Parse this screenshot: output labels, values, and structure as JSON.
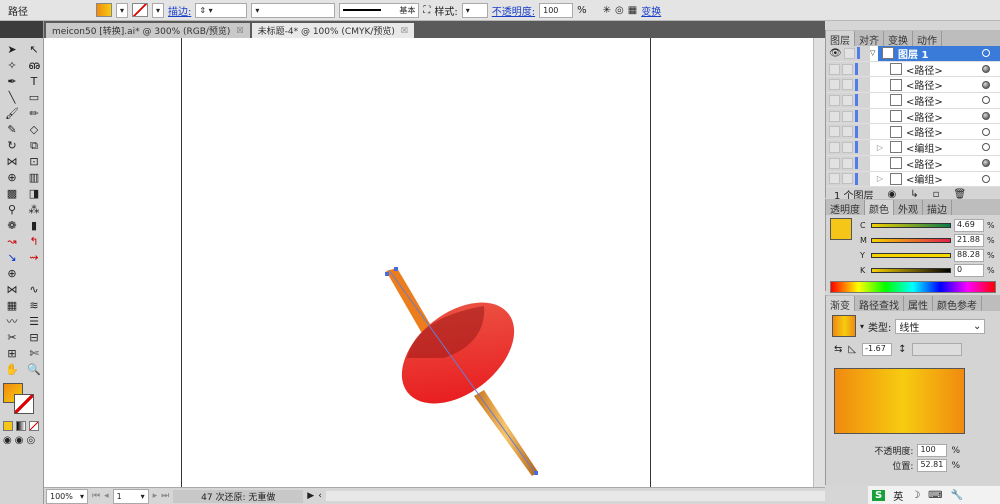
{
  "control_bar": {
    "object_type": "路径",
    "stroke_label": "描边:",
    "brush_label": "基本",
    "style_label": "样式:",
    "opacity_label": "不透明度:",
    "opacity_value": "100",
    "opacity_unit": "%",
    "transform_label": "变换"
  },
  "tabs": [
    {
      "label": "meicon50 [转换].ai* @ 300% (RGB/预览)",
      "active": false
    },
    {
      "label": "未标题-4* @ 100% (CMYK/预览)",
      "active": true
    }
  ],
  "status_bar": {
    "zoom": "100%",
    "page": "1",
    "message": "47 次还原: 无重做"
  },
  "layers_panel": {
    "tabs": [
      "图层",
      "对齐",
      "变换",
      "动作"
    ],
    "layer_name": "图层 1",
    "items": [
      {
        "name": "<路径>",
        "filled": true
      },
      {
        "name": "<路径>",
        "filled": true
      },
      {
        "name": "<路径>",
        "filled": false
      },
      {
        "name": "<路径>",
        "filled": true
      },
      {
        "name": "<路径>",
        "filled": false
      },
      {
        "name": "<编组>",
        "filled": false,
        "group": true
      },
      {
        "name": "<路径>",
        "filled": true
      },
      {
        "name": "<编组>",
        "filled": false,
        "group": true
      }
    ],
    "footer": "1 个图层"
  },
  "color_panel": {
    "tabs": [
      "透明度",
      "颜色",
      "外观",
      "描边"
    ],
    "swatch_color": "#f5c518",
    "channels": [
      {
        "label": "C",
        "value": "4.69",
        "color": "#0a7a4a"
      },
      {
        "label": "M",
        "value": "21.88",
        "color": "#e0204a"
      },
      {
        "label": "Y",
        "value": "88.28",
        "color": "#f5d800"
      },
      {
        "label": "K",
        "value": "0",
        "color": "#000000"
      }
    ],
    "unit": "%"
  },
  "gradient_panel": {
    "tabs": [
      "渐变",
      "路径查找",
      "属性",
      "颜色参考"
    ],
    "type_label": "类型:",
    "type_value": "线性",
    "angle": "-1.67",
    "opacity_label": "不透明度:",
    "opacity_value": "100",
    "location_label": "位置:",
    "location_value": "52.81",
    "unit": "%",
    "gradient_colors": [
      "#f08a10",
      "#f7cc10",
      "#f08a10"
    ]
  },
  "taskbar": {
    "ime": "英"
  }
}
